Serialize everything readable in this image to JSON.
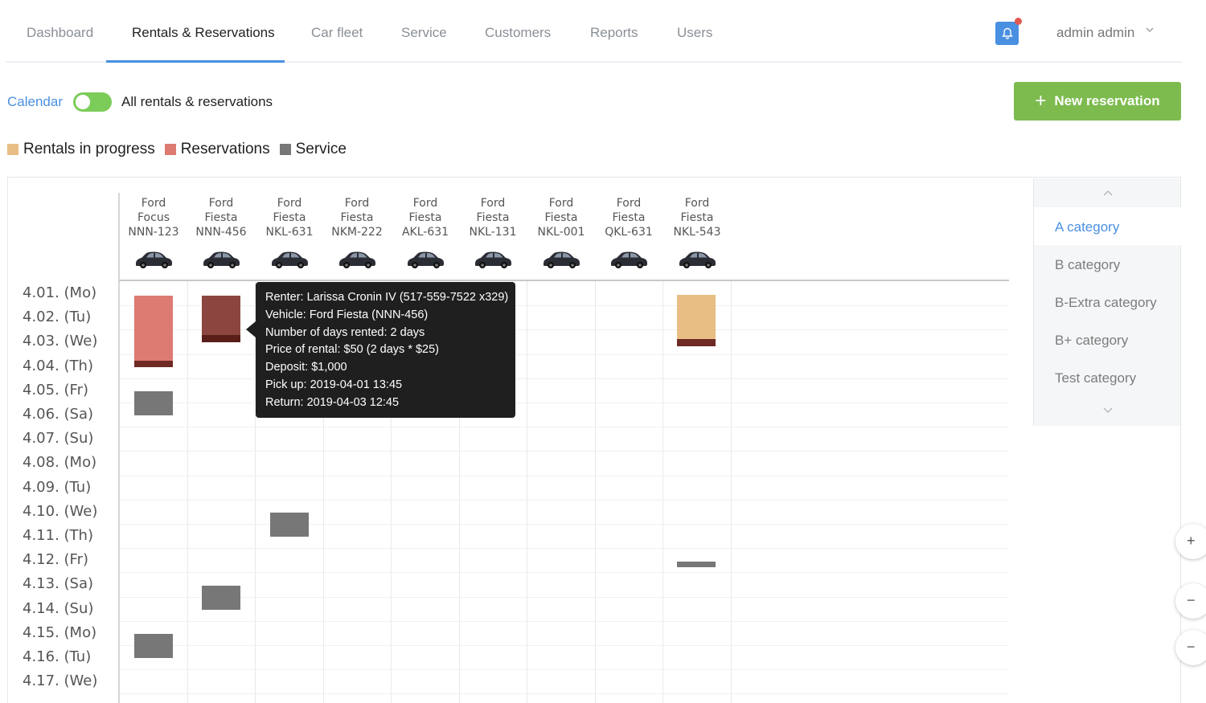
{
  "nav": {
    "tabs": [
      {
        "label": "Dashboard"
      },
      {
        "label": "Rentals & Reservations",
        "active": true
      },
      {
        "label": "Car fleet"
      },
      {
        "label": "Service"
      },
      {
        "label": "Customers"
      },
      {
        "label": "Reports"
      },
      {
        "label": "Users"
      }
    ],
    "user": "admin admin"
  },
  "toolbar": {
    "calendar_label": "Calendar",
    "toggle_on": true,
    "all_label": "All rentals & reservations",
    "new_button_label": "New reservation"
  },
  "legend": {
    "rentals": "Rentals in progress",
    "reservations": "Reservations",
    "service": "Service"
  },
  "colors": {
    "accent": "#4a90e2",
    "rental": "#e8be84",
    "reservation": "#dd7a72",
    "reservation_selected": "#8c453f",
    "service": "#777777",
    "cta": "#7dbb4f"
  },
  "vehicles": [
    {
      "make": "Ford",
      "model": "Focus",
      "plate": "NNN-123"
    },
    {
      "make": "Ford",
      "model": "Fiesta",
      "plate": "NNN-456"
    },
    {
      "make": "Ford",
      "model": "Fiesta",
      "plate": "NKL-631"
    },
    {
      "make": "Ford",
      "model": "Fiesta",
      "plate": "NKM-222"
    },
    {
      "make": "Ford",
      "model": "Fiesta",
      "plate": "AKL-631"
    },
    {
      "make": "Ford",
      "model": "Fiesta",
      "plate": "NKL-131"
    },
    {
      "make": "Ford",
      "model": "Fiesta",
      "plate": "NKL-001"
    },
    {
      "make": "Ford",
      "model": "Fiesta",
      "plate": "QKL-631"
    },
    {
      "make": "Ford",
      "model": "Fiesta",
      "plate": "NKL-543"
    }
  ],
  "days": [
    "4.01. (Mo)",
    "4.02. (Tu)",
    "4.03. (We)",
    "4.04. (Th)",
    "4.05. (Fr)",
    "4.06. (Sa)",
    "4.07. (Su)",
    "4.08. (Mo)",
    "4.09. (Tu)",
    "4.10. (We)",
    "4.11. (Th)",
    "4.12. (Fr)",
    "4.13. (Sa)",
    "4.14. (Su)",
    "4.15. (Mo)",
    "4.16. (Tu)",
    "4.17. (We)"
  ],
  "tooltip": {
    "renter": "Renter: Larissa Cronin IV (517-559-7522 x329)",
    "vehicle": "Vehicle: Ford Fiesta (NNN-456)",
    "days": "Number of days rented: 2 days",
    "price": "Price of rental: $50 (2 days * $25)",
    "deposit": "Deposit: $1,000",
    "pickup": "Pick up: 2019-04-01 13:45",
    "return": "Return: 2019-04-03 12:45"
  },
  "categories": [
    {
      "label": "A category",
      "active": true
    },
    {
      "label": "B category"
    },
    {
      "label": "B-Extra category"
    },
    {
      "label": "B+ category"
    },
    {
      "label": "Test category"
    }
  ]
}
